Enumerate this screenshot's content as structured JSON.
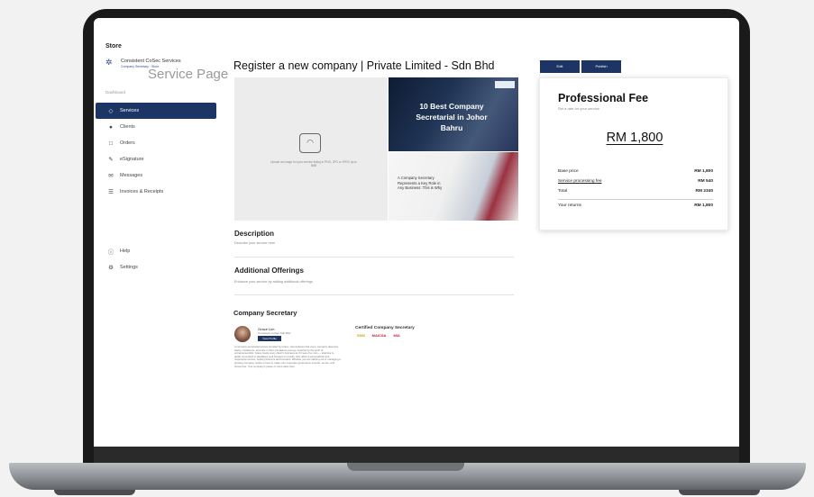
{
  "sidebar": {
    "store_title": "Store",
    "brand_name": "Consistent CoSec Services",
    "brand_sub": "Company Secretary · Store",
    "section_label": "Dashboard",
    "items": [
      {
        "label": "Services",
        "icon": "tag-icon",
        "active": true
      },
      {
        "label": "Clients",
        "icon": "users-icon"
      },
      {
        "label": "Orders",
        "icon": "clipboard-icon"
      },
      {
        "label": "eSignature",
        "icon": "pen-icon"
      },
      {
        "label": "Messages",
        "icon": "mail-icon"
      },
      {
        "label": "Invoices & Receipts",
        "icon": "receipt-icon"
      }
    ],
    "bottom_items": [
      {
        "label": "Help",
        "icon": "help-icon"
      },
      {
        "label": "Settings",
        "icon": "gear-icon"
      }
    ]
  },
  "overlay_label": "Service Page",
  "main": {
    "title": "Register a new company | Private Limited - Sdn Bhd",
    "upload_hint": "Upload an image for your service listing in PNG, JPG or JPEG up to 5MB",
    "image_top_text": "10 Best Company Secretarial in Johor Bahru",
    "image_bottom_text": "A Company Secretary Represents a Key Role in Any Business: This is Why",
    "description": {
      "title": "Description",
      "subtitle": "Describe your service here"
    },
    "additional": {
      "title": "Additional Offerings",
      "subtitle": "Enhance your service by adding additional offerings"
    },
    "company_secretary": {
      "title": "Company Secretary",
      "name": "Grace Lim",
      "role": "Consistent CoSec Sdn Bhd",
      "button": "View Profile",
      "bio": "A company secretarial service founded by Grace, who believes that every company deserves clarity, confidence, and care in their compliance journey. Inspired by the spirit of entrepreneurship, Grace treats every client's business as if it were her own — attentive to detail, committed to deadlines, and focused on results. She offers a personalized and responsive service, helping directors and founders. Whether you are starting out or managing a growing company, Grace is here to make your corporate governance smooth, secure, and stress-free. Your company's peace of mind starts here."
    },
    "certified": {
      "title": "Certified Company Secretary",
      "logos": [
        "SSM",
        "MAICSA",
        "MIA"
      ]
    }
  },
  "actions": {
    "edit": "Edit",
    "publish": "Publish"
  },
  "fee": {
    "title": "Professional Fee",
    "subtitle": "Set a rate for your service",
    "amount": "RM 1,800",
    "rows": [
      {
        "label": "Base price",
        "value": "RM 1,800"
      },
      {
        "label": "Service processing fee",
        "value": "RM 540"
      },
      {
        "label": "Total",
        "value": "RM 2340"
      }
    ],
    "returns": {
      "label": "Your returns",
      "value": "RM 1,800"
    }
  },
  "colors": {
    "accent": "#1c3565",
    "frame": "#1a1a1a"
  }
}
